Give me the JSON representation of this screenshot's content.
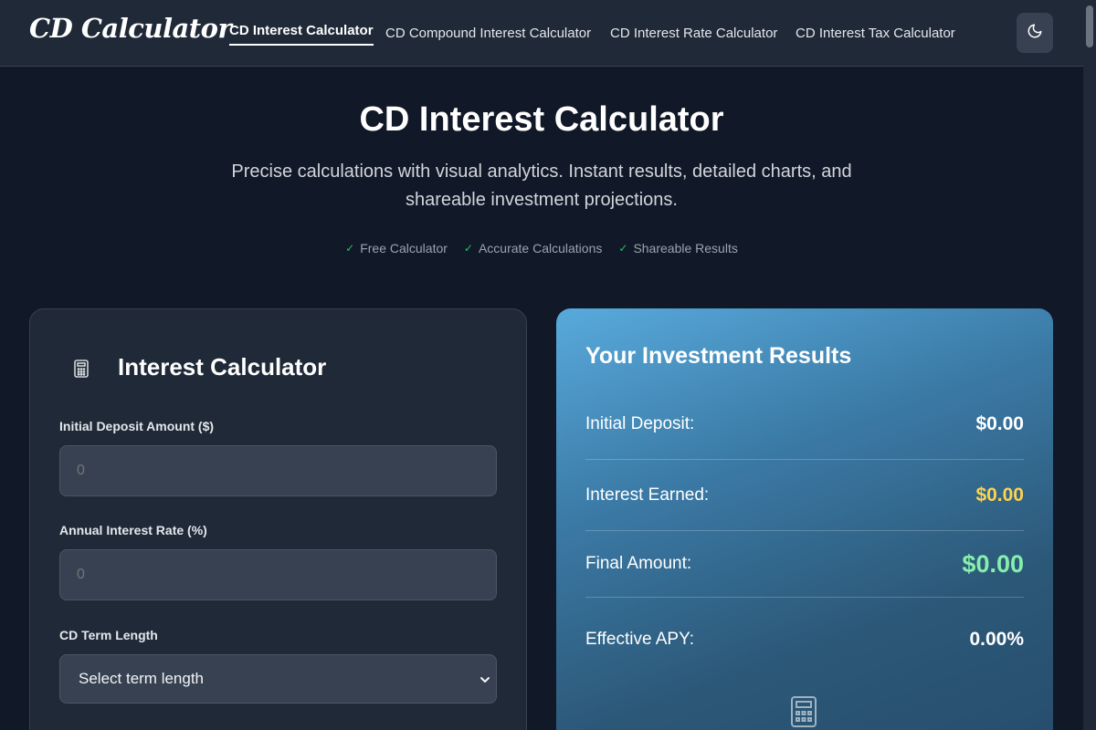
{
  "nav": {
    "logo": "CD Calculator",
    "links": [
      {
        "label": "CD Interest Calculator",
        "active": true
      },
      {
        "label": "CD Compound Interest Calculator",
        "active": false
      },
      {
        "label": "CD Interest Rate Calculator",
        "active": false
      },
      {
        "label": "CD Interest Tax Calculator",
        "active": false
      }
    ],
    "theme_toggle_icon": "moon-icon"
  },
  "hero": {
    "title": "CD Interest Calculator",
    "subtitle": "Precise calculations with visual analytics. Instant results, detailed charts, and shareable investment projections.",
    "features": [
      "Free Calculator",
      "Accurate Calculations",
      "Shareable Results"
    ]
  },
  "calculator": {
    "title": "Interest Calculator",
    "icon": "calculator-icon",
    "fields": [
      {
        "label": "Initial Deposit Amount ($)",
        "value": "",
        "placeholder": "0"
      },
      {
        "label": "Annual Interest Rate (%)",
        "value": "",
        "placeholder": "0"
      },
      {
        "label": "CD Term Length",
        "selected": "Select term length"
      }
    ]
  },
  "results": {
    "title": "Your Investment Results",
    "rows": [
      {
        "label": "Initial Deposit:",
        "value": "$0.00"
      },
      {
        "label": "Interest Earned:",
        "value": "$0.00"
      },
      {
        "label": "Final Amount:",
        "value": "$0.00"
      },
      {
        "label": "Effective APY:",
        "value": "0.00%"
      }
    ],
    "icon": "calculator-icon"
  },
  "colors": {
    "background": "#111827",
    "card": "#1f2937",
    "check": "#22c55e",
    "interest_value": "#fcd34d",
    "final_value": "#86efac",
    "results_gradient_start": "#58aadc",
    "results_gradient_end": "#274d6d"
  }
}
